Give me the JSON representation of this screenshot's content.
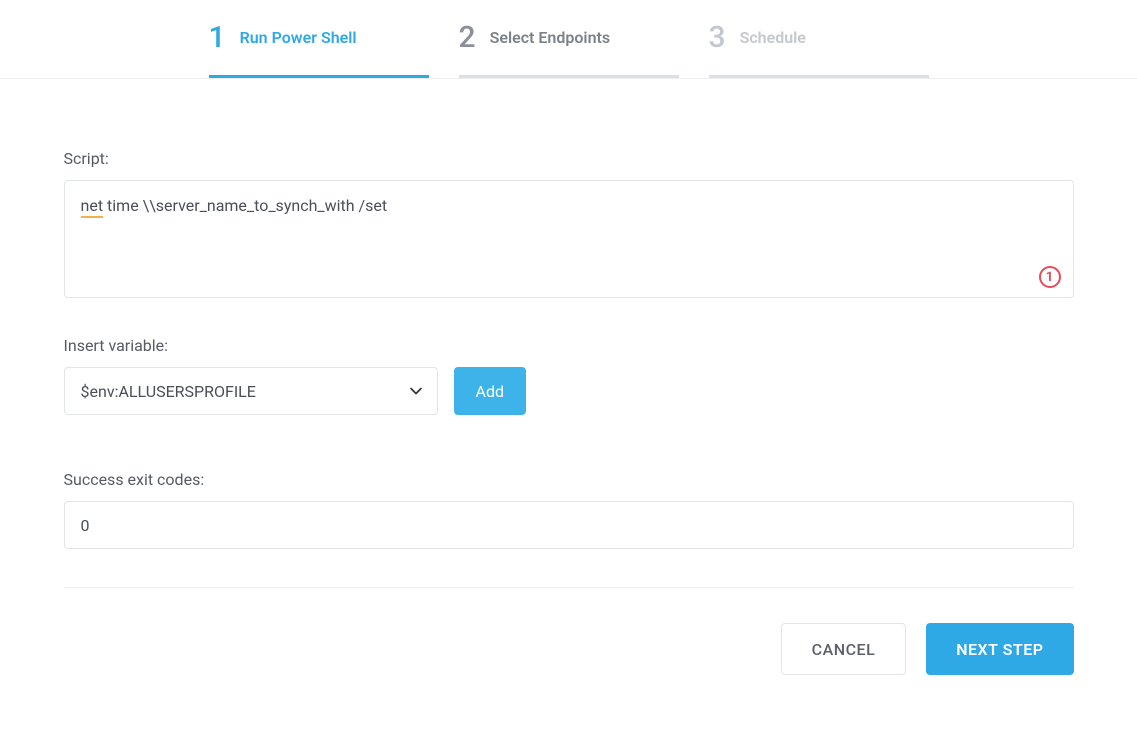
{
  "wizard": {
    "steps": [
      {
        "number": "1",
        "label": "Run Power Shell"
      },
      {
        "number": "2",
        "label": "Select Endpoints"
      },
      {
        "number": "3",
        "label": "Schedule"
      }
    ]
  },
  "labels": {
    "script": "Script:",
    "insert_variable": "Insert variable:",
    "success_exit_codes": "Success exit codes:"
  },
  "script": {
    "underlined_token": "net",
    "rest": " time \\\\server_name_to_synch_with /set",
    "warning_count": "1"
  },
  "variable": {
    "selected": "$env:ALLUSERSPROFILE",
    "add_label": "Add"
  },
  "exit_codes": {
    "value": "0"
  },
  "actions": {
    "cancel": "CANCEL",
    "next": "NEXT STEP"
  }
}
